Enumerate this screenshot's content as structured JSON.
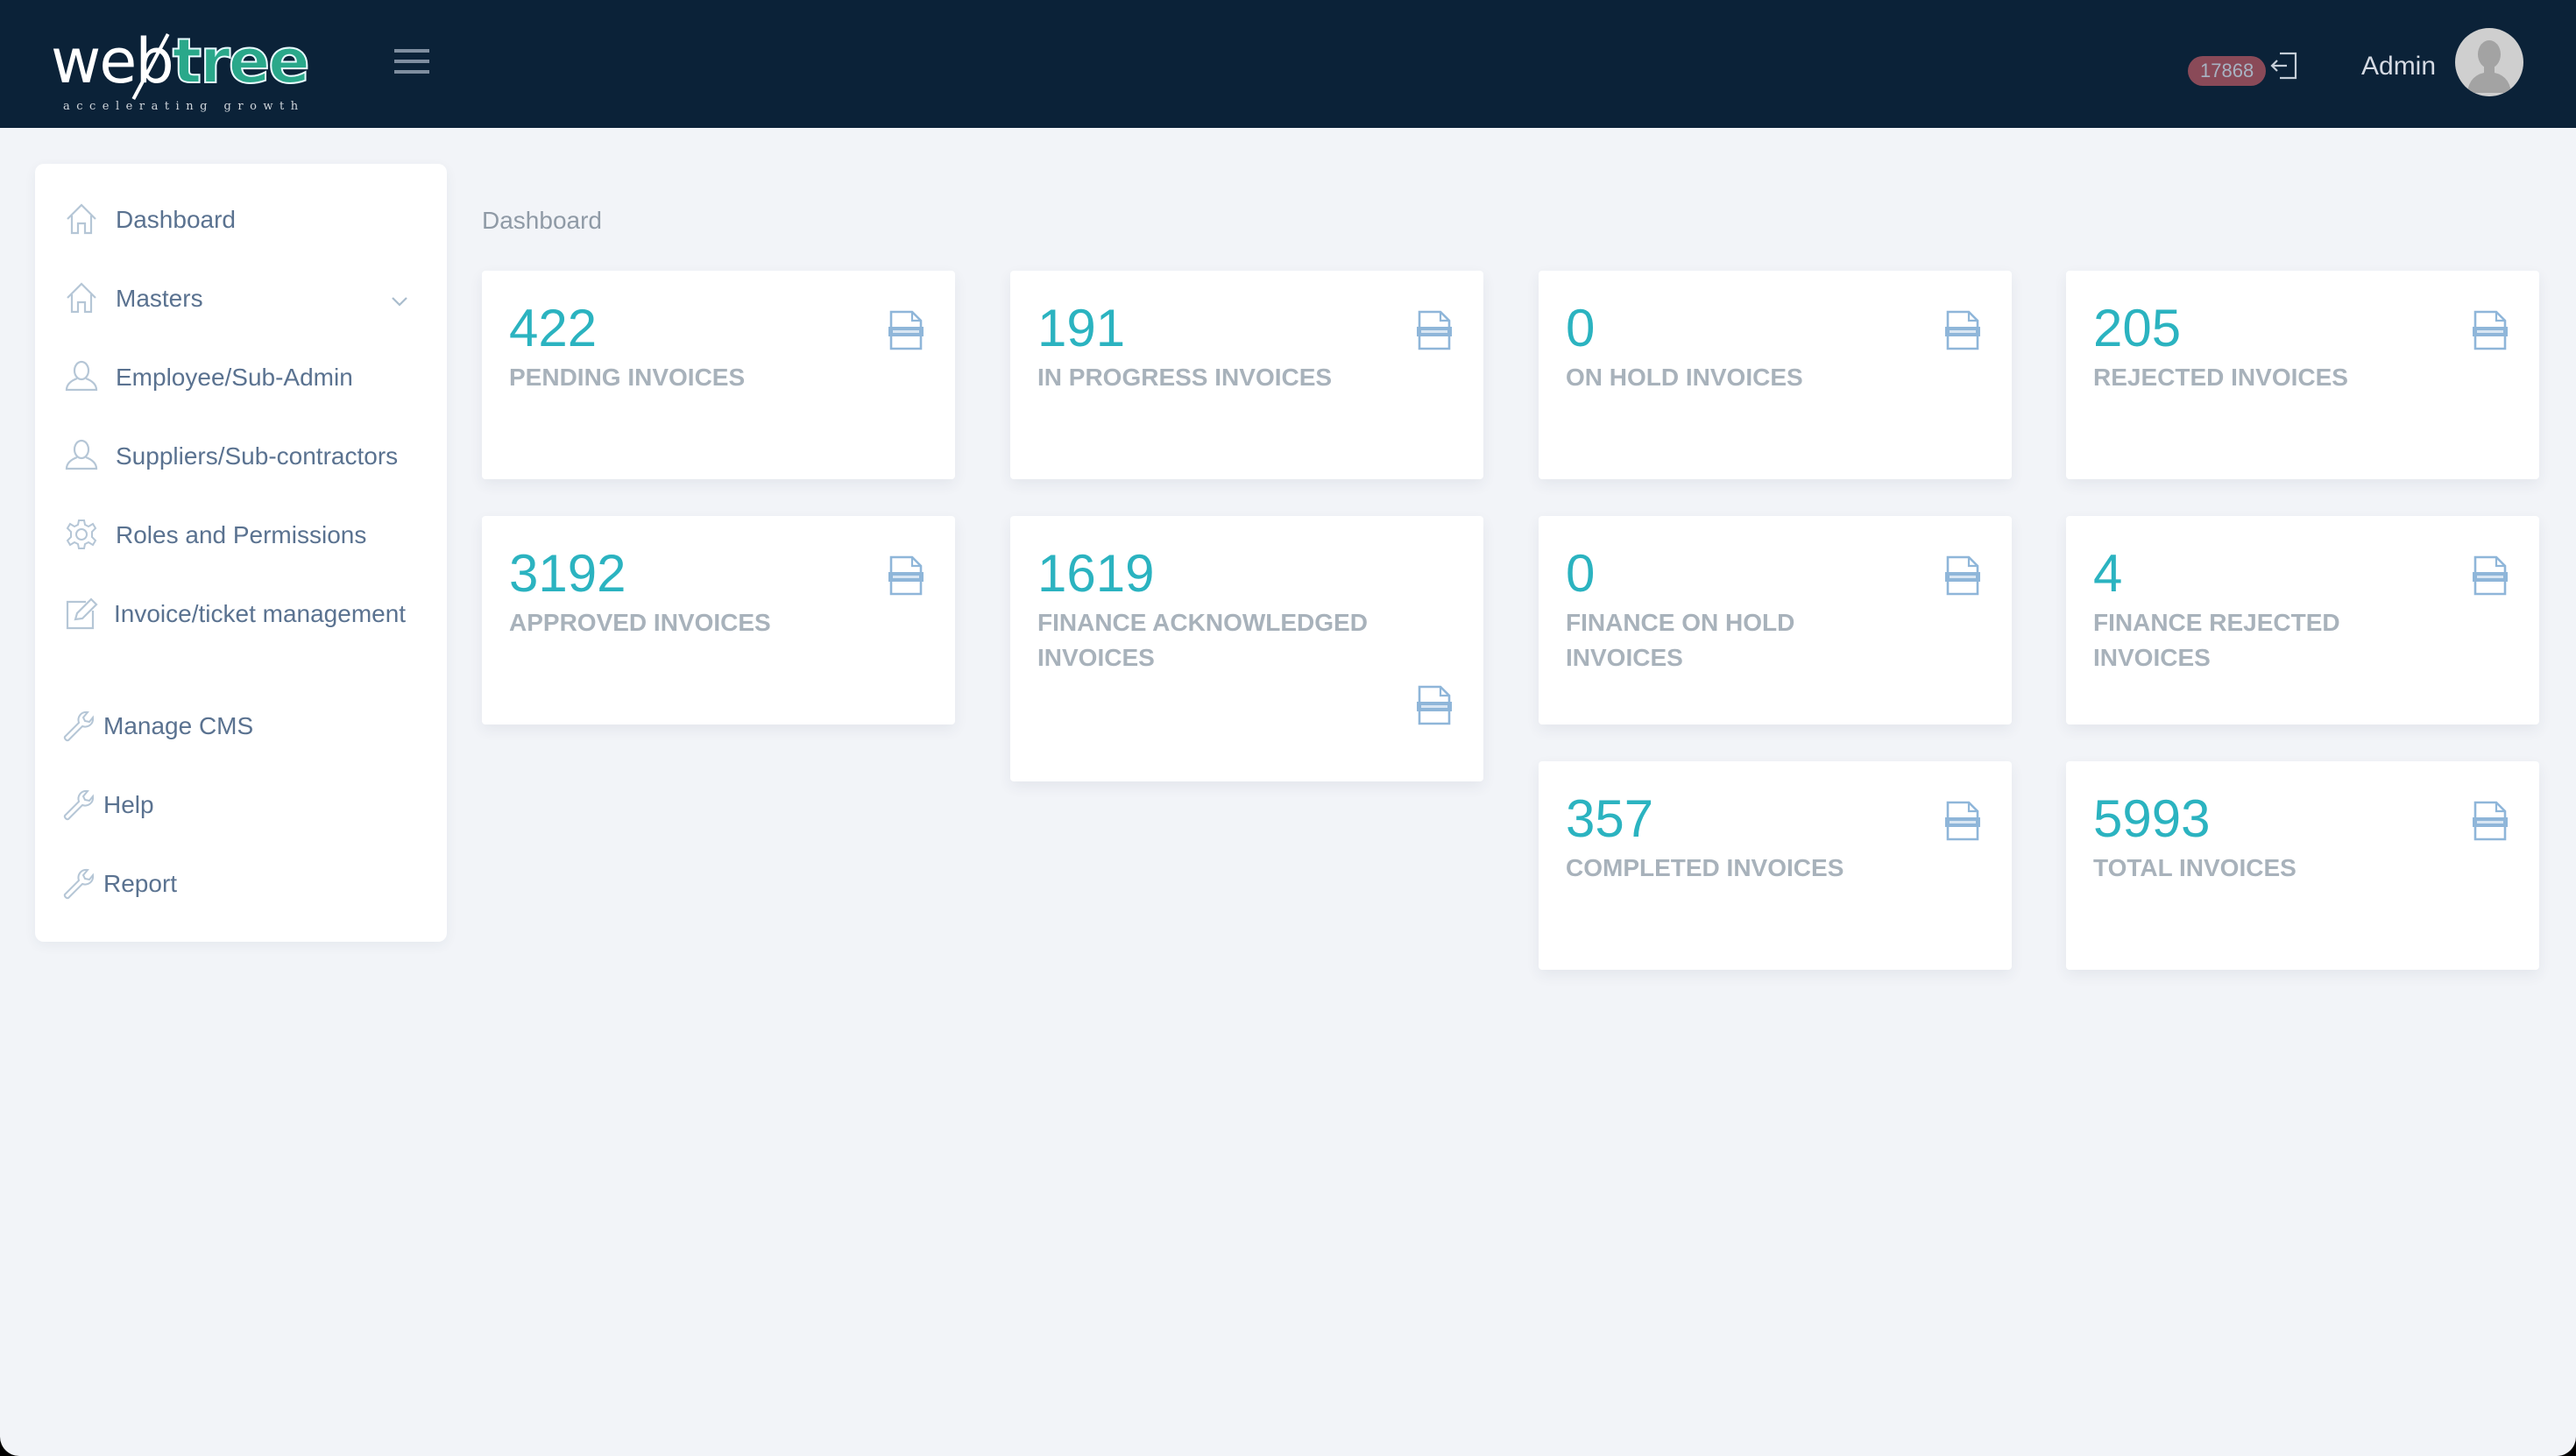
{
  "header": {
    "logo_word_a": "web",
    "logo_word_b": "tree",
    "logo_tagline": "accelerating growth",
    "menu_icon": "hamburger-icon",
    "notification_count": "17868",
    "logout_icon": "logout-icon",
    "user_name": "Admin",
    "avatar_icon": "user-avatar-icon"
  },
  "sidebar": {
    "items": [
      {
        "label": "Dashboard",
        "icon": "home-icon"
      },
      {
        "label": "Masters",
        "icon": "home-icon",
        "expandable": true
      },
      {
        "label": "Employee/Sub-Admin",
        "icon": "user-icon"
      },
      {
        "label": "Suppliers/Sub-contractors",
        "icon": "user-icon"
      },
      {
        "label": "Roles and Permissions",
        "icon": "gear-icon"
      },
      {
        "label": "Invoice/ticket management",
        "icon": "edit-icon"
      },
      {
        "label": "Manage CMS",
        "icon": "wrench-icon"
      },
      {
        "label": "Help",
        "icon": "wrench-icon"
      },
      {
        "label": "Report",
        "icon": "wrench-icon"
      }
    ]
  },
  "main": {
    "breadcrumb": "Dashboard",
    "cards": [
      {
        "value": "422",
        "label": "PENDING INVOICES"
      },
      {
        "value": "191",
        "label": "IN PROGRESS INVOICES"
      },
      {
        "value": "0",
        "label": "ON HOLD INVOICES"
      },
      {
        "value": "205",
        "label": "REJECTED INVOICES"
      },
      {
        "value": "3192",
        "label": "APPROVED INVOICES"
      },
      {
        "value": "1619",
        "label": "FINANCE ACKNOWLEDGED INVOICES"
      },
      {
        "value": "0",
        "label": "FINANCE ON HOLD INVOICES"
      },
      {
        "value": "4",
        "label": "FINANCE REJECTED INVOICES"
      },
      {
        "value": "357",
        "label": "COMPLETED INVOICES"
      },
      {
        "value": "5993",
        "label": "TOTAL INVOICES"
      }
    ]
  },
  "colors": {
    "header_bg": "#0b2238",
    "page_bg": "#f2f4f8",
    "accent_number": "#2bb3c0",
    "label_gray": "#a8b2bb",
    "nav_text": "#5a7290",
    "badge_bg": "#8a4a58"
  }
}
